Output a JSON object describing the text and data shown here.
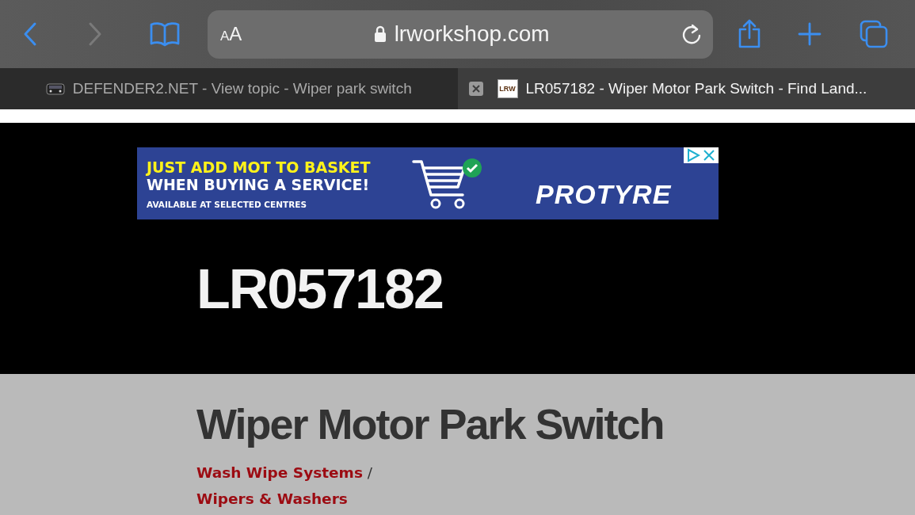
{
  "toolbar": {
    "text_size": "AA",
    "url": "lrworkshop.com",
    "back_disabled": false,
    "forward_disabled": true
  },
  "tabs": [
    {
      "title": "DEFENDER2.NET - View topic - Wiper park switch",
      "selected": false
    },
    {
      "title": "LR057182 - Wiper Motor Park Switch - Find Land...",
      "selected": true,
      "favicon_text": "LRW"
    }
  ],
  "ad": {
    "line_1": "JUST ADD MOT TO BASKET",
    "line_2": "WHEN BUYING A SERVICE!",
    "line_3": "AVAILABLE AT SELECTED CENTRES",
    "logo": "PROTYRE"
  },
  "header": {
    "part_number": "LR057182"
  },
  "content": {
    "title": "Wiper Motor Park Switch",
    "breadcrumb": [
      "Wash Wipe Systems",
      "Wipers & Washers"
    ],
    "separator": "/"
  }
}
